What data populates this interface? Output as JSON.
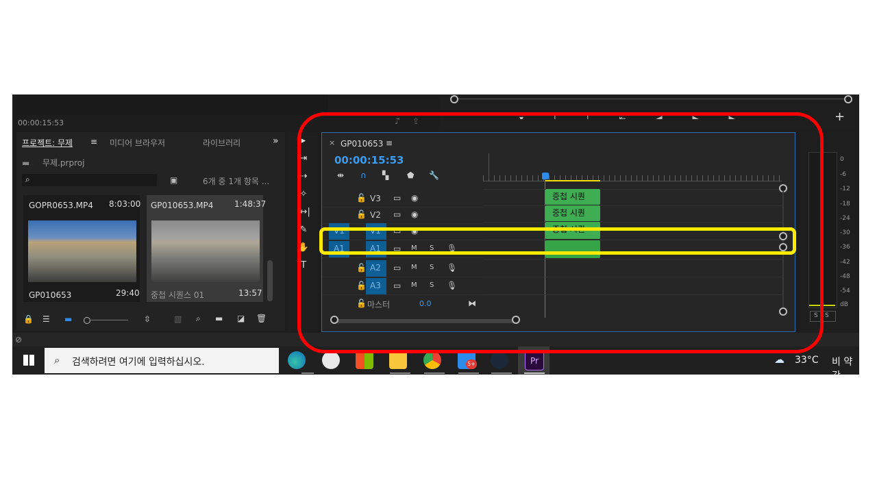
{
  "source_monitor": {
    "timecode": "00:00:15:53"
  },
  "project_panel": {
    "tabs": [
      "프로젝트: 무제",
      "미디어 브라우저",
      "라이브러리"
    ],
    "more_label": "»",
    "menu_icon": "≡",
    "project_file": "무제.prproj",
    "item_count": "6개 중 1개 항목 ...",
    "items": [
      {
        "name": "GOPR0653.MP4",
        "duration": "8:03:00"
      },
      {
        "name": "GP010653.MP4",
        "duration": "1:48:37"
      },
      {
        "name": "GP010653",
        "duration": "29:40"
      },
      {
        "name": "중첩 시퀀스 01",
        "duration": "13:57"
      }
    ]
  },
  "timeline": {
    "sequence_tab": "GP010653",
    "close": "×",
    "menu_icon": "≡",
    "timecode": "00:00:15:53",
    "tracks": [
      {
        "source": "",
        "name": "V3",
        "kind": "video"
      },
      {
        "source": "",
        "name": "V2",
        "kind": "video"
      },
      {
        "source": "V1",
        "name": "V1",
        "kind": "video"
      },
      {
        "source": "A1",
        "name": "A1",
        "kind": "audio"
      },
      {
        "source": "",
        "name": "A2",
        "kind": "audio"
      },
      {
        "source": "",
        "name": "A3",
        "kind": "audio"
      }
    ],
    "audio_m": "M",
    "audio_s": "S",
    "master_label": "마스터",
    "master_value": "0.0",
    "clips": [
      "중첩 시퀀",
      "중첩 시퀀",
      "중첩 시퀀"
    ],
    "colors": {
      "clip": "#3fae52",
      "playhead": "#2d8ceb",
      "track_target": "#0e5f96"
    }
  },
  "audio_meter": {
    "ticks": [
      "0",
      "-6",
      "-12",
      "-18",
      "-24",
      "-30",
      "-36",
      "-42",
      "-48",
      "-54",
      "dB"
    ],
    "solo_labels": [
      "S",
      "S"
    ]
  },
  "annotations": {
    "red_box": "#ff0000",
    "yellow_box": "#ffea00"
  },
  "taskbar": {
    "search_placeholder": "검색하려면 여기에 입력하십시오.",
    "weather_temp": "33°C",
    "weather_desc": "비 약간",
    "badge": "5+",
    "premiere_label": "Pr"
  }
}
